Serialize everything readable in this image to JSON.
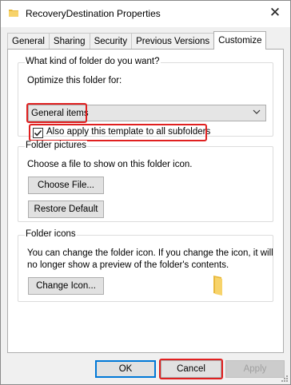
{
  "window": {
    "title": "RecoveryDestination Properties"
  },
  "tabs": [
    {
      "label": "General"
    },
    {
      "label": "Sharing"
    },
    {
      "label": "Security"
    },
    {
      "label": "Previous Versions"
    },
    {
      "label": "Customize"
    }
  ],
  "folder_type": {
    "group_title": "What kind of folder do you want?",
    "optimize_label": "Optimize this folder for:",
    "selected": "General items",
    "apply_all_label": "Also apply this template to all subfolders",
    "apply_all_checked": true
  },
  "folder_pictures": {
    "group_title": "Folder pictures",
    "instruction": "Choose a file to show on this folder icon.",
    "choose_file_label": "Choose File...",
    "restore_default_label": "Restore Default"
  },
  "folder_icons": {
    "group_title": "Folder icons",
    "description_line1": "You can change the folder icon. If you change the icon, it will",
    "description_line2": "no longer show a preview of the folder's contents.",
    "change_icon_label": "Change Icon..."
  },
  "footer": {
    "ok_label": "OK",
    "cancel_label": "Cancel",
    "apply_label": "Apply",
    "apply_enabled": false
  },
  "highlight_color": "#e02020",
  "icons": [
    "folder-icon",
    "close-icon",
    "chevron-down-icon",
    "checkmark-icon",
    "resize-grip-icon"
  ]
}
